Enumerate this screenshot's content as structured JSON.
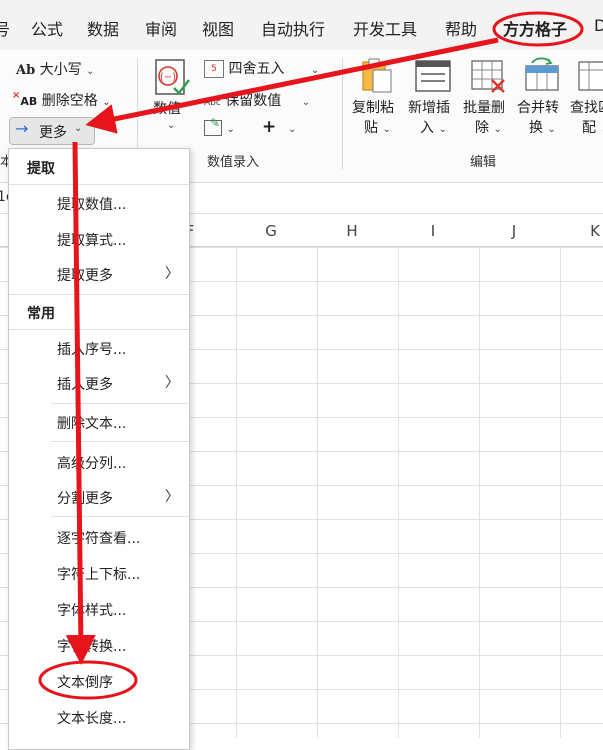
{
  "tabs": [
    "号",
    "公式",
    "数据",
    "审阅",
    "视图",
    "自动执行",
    "开发工具",
    "帮助",
    "方方格子",
    "D"
  ],
  "active_tab": "方方格子",
  "ribbon": {
    "case_btn": "大小写",
    "case_prefix": "Ab",
    "delete_space_btn": "删除空格",
    "delete_space_prefix": "AB",
    "more_btn": "更多",
    "numeric_btn": "数值",
    "round_btn": "四舍五入",
    "keep_value_btn": "保留数值",
    "keep_value_prefix": "Abc",
    "plus_btn": "+",
    "group_text": "本",
    "group_numeric": "数值录入",
    "group_edit": "编辑",
    "big_buttons": [
      {
        "line1": "复制粘",
        "line2": "贴"
      },
      {
        "line1": "新增插",
        "line2": "入"
      },
      {
        "line1": "批量删",
        "line2": "除"
      },
      {
        "line1": "合并转",
        "line2": "换"
      },
      {
        "line1": "查找匹",
        "line2": "配"
      }
    ]
  },
  "formula_bar": {
    "name_box_fragment": "1c"
  },
  "columns": [
    "F",
    "G",
    "H",
    "I",
    "J",
    "K"
  ],
  "menu": {
    "sections": [
      {
        "title": "提取",
        "items": [
          {
            "label": "提取数值...",
            "submenu": false
          },
          {
            "label": "提取算式...",
            "submenu": false
          },
          {
            "label": "提取更多",
            "submenu": true
          }
        ]
      },
      {
        "title": "常用",
        "items": [
          {
            "label": "插入序号...",
            "submenu": false
          },
          {
            "label": "插入更多",
            "submenu": true
          },
          {
            "label": "删除文本...",
            "submenu": false
          },
          {
            "label": "高级分列...",
            "submenu": false
          },
          {
            "label": "分割更多",
            "submenu": true
          },
          {
            "label": "逐字符查看...",
            "submenu": false
          },
          {
            "label": "字符上下标...",
            "submenu": false
          },
          {
            "label": "字体样式...",
            "submenu": false
          },
          {
            "label": "字符转换...",
            "submenu": false
          },
          {
            "label": "文本倒序",
            "submenu": false
          },
          {
            "label": "文本长度...",
            "submenu": false
          }
        ]
      }
    ]
  },
  "colors": {
    "annotation": "#e8141b",
    "arrow_blue": "#2b6fd6",
    "ribbon_green": "#2e9f52",
    "icon_red": "#d9332b"
  }
}
